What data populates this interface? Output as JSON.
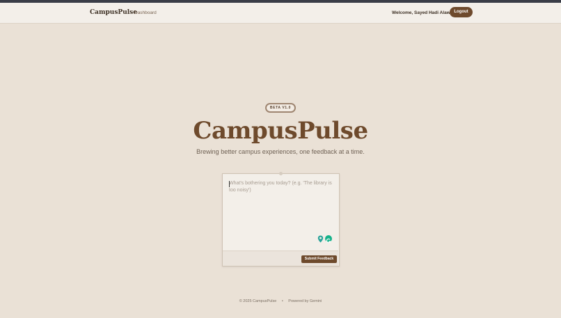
{
  "nav": {
    "brand": "CampusPulse",
    "dashboard_link": "Dashboard",
    "welcome_text": "Welcome, Sayed Hadi Alawi",
    "logout_label": "Logout"
  },
  "hero": {
    "badge": "BETA V1.0",
    "title": "CampusPulse",
    "subtitle": "Brewing better campus experiences, one feedback at a time."
  },
  "feedback": {
    "placeholder": "What's bothering you today? (e.g. 'The library is too noisy')",
    "value": "",
    "submit_label": "Submit Feedback"
  },
  "footer": {
    "copyright": "© 2025 CampusPulse",
    "separator": "•",
    "powered": "Powered by Gemini"
  },
  "colors": {
    "accent": "#6e4a2c",
    "background": "#eae1d6",
    "navbar": "#f3efe9"
  },
  "icons": [
    "location-pin-icon",
    "grammarly-icon"
  ]
}
